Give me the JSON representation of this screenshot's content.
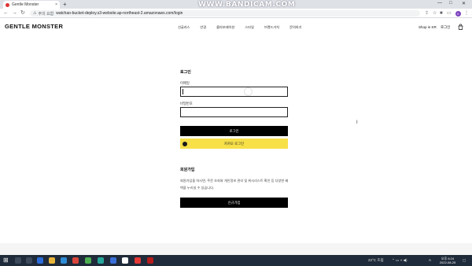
{
  "browser": {
    "tab_title": "Gentle Monster",
    "tab_close": "×",
    "new_tab": "+",
    "watermark": "WWW.BANDICAM.COM",
    "window_controls": [
      "—",
      "□",
      "✕"
    ],
    "nav": {
      "back": "←",
      "forward": "→",
      "reload": "↻"
    },
    "security_icon": "⚠",
    "security_label": "주의 요함",
    "url": "watchao-bucket-deploy.s3-website.ap-northeast-2.amazonaws.com/login",
    "profile_initial": "K"
  },
  "header": {
    "logo": "GENTLE MONSTER",
    "nav": [
      "선글라스",
      "안경",
      "콜라보레이션",
      "스타일",
      "브랜드가치",
      "문의하기"
    ],
    "shop_region": "Shop in KR",
    "login": "로그인",
    "bag_icon": "shopping-bag-icon"
  },
  "login": {
    "title": "로그인",
    "email_label": "이메일",
    "email_value": "",
    "password_label": "비밀번호",
    "password_value": "",
    "submit_label": "로그인",
    "kakao_label": "카카오 로그인"
  },
  "signup": {
    "title": "회원가입",
    "description": "회원가입을 하시면, 주문 조회와 개인정보 관리 및 위시리스트 확인 등 다양한 혜택을 누리실 수 있습니다.",
    "button_label": "신규가입"
  },
  "taskbar": {
    "start": "⊞",
    "weather": "22°C 흐림",
    "ime": "A",
    "time": "오후 6:24",
    "date": "2022-08-25"
  },
  "colors": {
    "kakao": "#f7e048",
    "button_black": "#000000",
    "taskbar": "#1f2b3a"
  }
}
